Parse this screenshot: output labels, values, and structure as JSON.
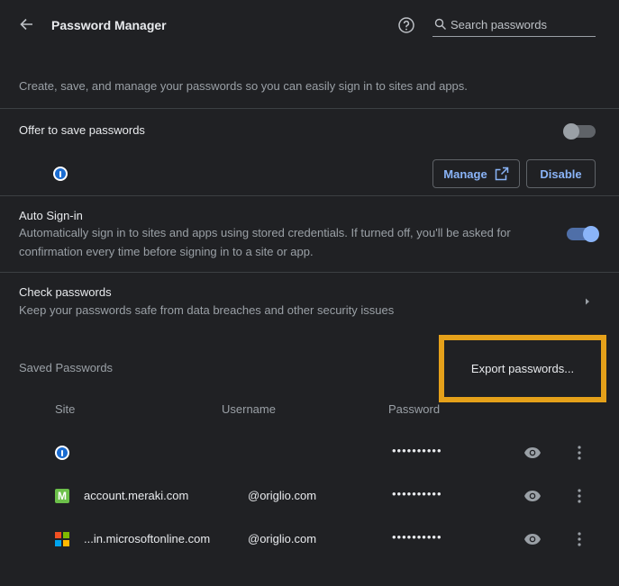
{
  "header": {
    "title": "Password Manager",
    "search_placeholder": "Search passwords"
  },
  "description": "Create, save, and manage your passwords so you can easily sign in to sites and apps.",
  "offer_save": {
    "label": "Offer to save passwords",
    "enabled": false,
    "extension_icon": "1password-icon",
    "manage_label": "Manage",
    "disable_label": "Disable"
  },
  "auto_signin": {
    "label": "Auto Sign-in",
    "description": "Automatically sign in to sites and apps using stored credentials. If turned off, you'll be asked for confirmation every time before signing in to a site or app.",
    "enabled": true
  },
  "check_passwords": {
    "label": "Check passwords",
    "description": "Keep your passwords safe from data breaches and other security issues"
  },
  "saved_passwords": {
    "label": "Saved Passwords",
    "export_label": "Export passwords...",
    "columns": [
      "Site",
      "Username",
      "Password"
    ],
    "rows": [
      {
        "icon": "1password-icon",
        "site": "",
        "username": "",
        "password": "••••••••••"
      },
      {
        "icon": "meraki-icon",
        "site": "account.meraki.com",
        "username": "@origlio.com",
        "password": "••••••••••"
      },
      {
        "icon": "microsoft-icon",
        "site": "...in.microsoftonline.com",
        "username": "@origlio.com",
        "password": "••••••••••"
      }
    ]
  },
  "colors": {
    "background": "#202124",
    "accent": "#8ab4f8",
    "highlight": "#e5a11a"
  }
}
